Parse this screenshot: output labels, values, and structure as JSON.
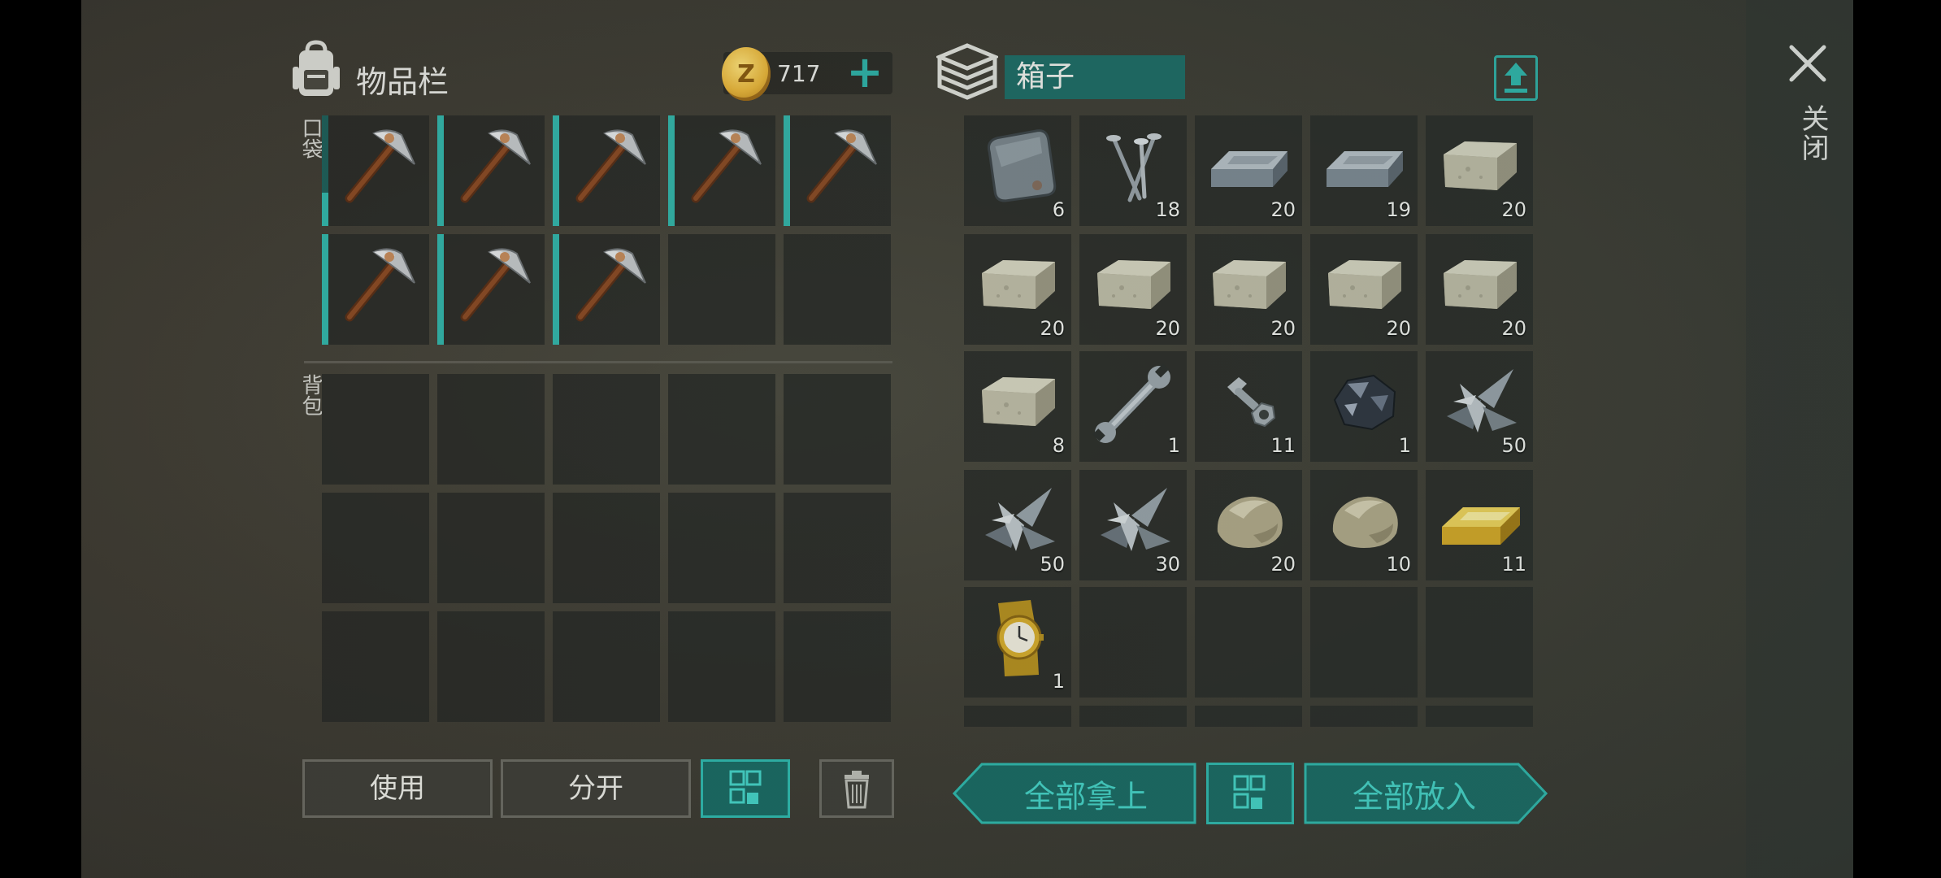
{
  "inventory": {
    "title": "物品栏",
    "pocket_label": "口袋",
    "backpack_label": "背包",
    "gold": "717",
    "add_gold": "+"
  },
  "box": {
    "title": "箱子"
  },
  "close_label": "关闭",
  "pocket_items": [
    {
      "name": "pickaxe",
      "durability": 0.3
    },
    {
      "name": "pickaxe",
      "durability": 1.0
    },
    {
      "name": "pickaxe",
      "durability": 1.0
    },
    {
      "name": "pickaxe",
      "durability": 1.0
    },
    {
      "name": "pickaxe",
      "durability": 1.0
    },
    {
      "name": "pickaxe",
      "durability": 1.0
    },
    {
      "name": "pickaxe",
      "durability": 1.0
    },
    {
      "name": "pickaxe",
      "durability": 1.0
    },
    null,
    null
  ],
  "box_items": [
    {
      "icon": "metal-plate",
      "qty": "6"
    },
    {
      "icon": "nails",
      "qty": "18"
    },
    {
      "icon": "iron-ingot",
      "qty": "20"
    },
    {
      "icon": "iron-ingot",
      "qty": "19"
    },
    {
      "icon": "limestone-block",
      "qty": "20"
    },
    {
      "icon": "limestone-block",
      "qty": "20"
    },
    {
      "icon": "limestone-block",
      "qty": "20"
    },
    {
      "icon": "limestone-block",
      "qty": "20"
    },
    {
      "icon": "limestone-block",
      "qty": "20"
    },
    {
      "icon": "limestone-block",
      "qty": "20"
    },
    {
      "icon": "limestone-block",
      "qty": "8"
    },
    {
      "icon": "wrench",
      "qty": "1"
    },
    {
      "icon": "bolt-nut",
      "qty": "11"
    },
    {
      "icon": "iron-ore",
      "qty": "1"
    },
    {
      "icon": "scrap-metal",
      "qty": "50"
    },
    {
      "icon": "scrap-metal",
      "qty": "50"
    },
    {
      "icon": "scrap-metal",
      "qty": "30"
    },
    {
      "icon": "stone",
      "qty": "20"
    },
    {
      "icon": "stone",
      "qty": "10"
    },
    {
      "icon": "gold-bar",
      "qty": "11"
    },
    {
      "icon": "gold-watch",
      "qty": "1"
    },
    null,
    null,
    null,
    null
  ],
  "buttons": {
    "use": "使用",
    "split": "分开",
    "take_all": "全部拿上",
    "put_all": "全部放入"
  },
  "colors": {
    "accent": "#2fb8ad",
    "accent_dark": "#1a6a63",
    "slot_bg": "#262825"
  }
}
